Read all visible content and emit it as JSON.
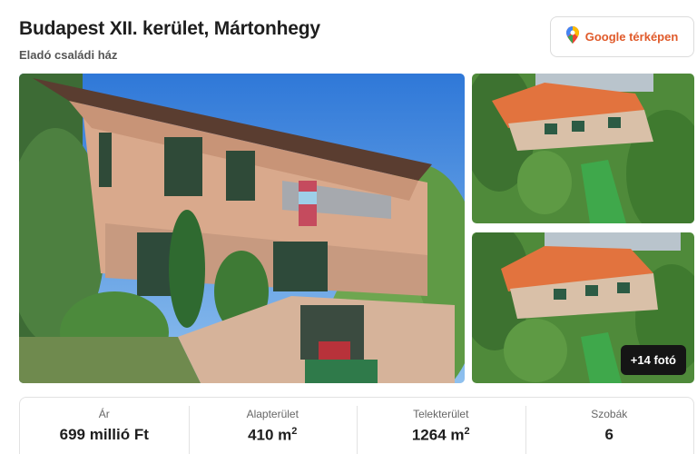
{
  "listing": {
    "title": "Budapest XII. kerület, Mártonhegy",
    "subtitle": "Eladó családi ház"
  },
  "map_button": {
    "label": "Google térképen",
    "icon": "map-pin-icon"
  },
  "gallery": {
    "more_badge": "+14 fotó",
    "main_photo": "house-front-photo",
    "side_photos": [
      "aerial-view-photo",
      "aerial-view-photo-2"
    ]
  },
  "stats": [
    {
      "label": "Ár",
      "value": "699 millió Ft",
      "unit_sup": ""
    },
    {
      "label": "Alapterület",
      "value": "410 m",
      "unit_sup": "2"
    },
    {
      "label": "Telekterület",
      "value": "1264 m",
      "unit_sup": "2"
    },
    {
      "label": "Szobák",
      "value": "6",
      "unit_sup": ""
    }
  ],
  "colors": {
    "accent": "#e05a2a",
    "badge_bg": "#151515"
  }
}
